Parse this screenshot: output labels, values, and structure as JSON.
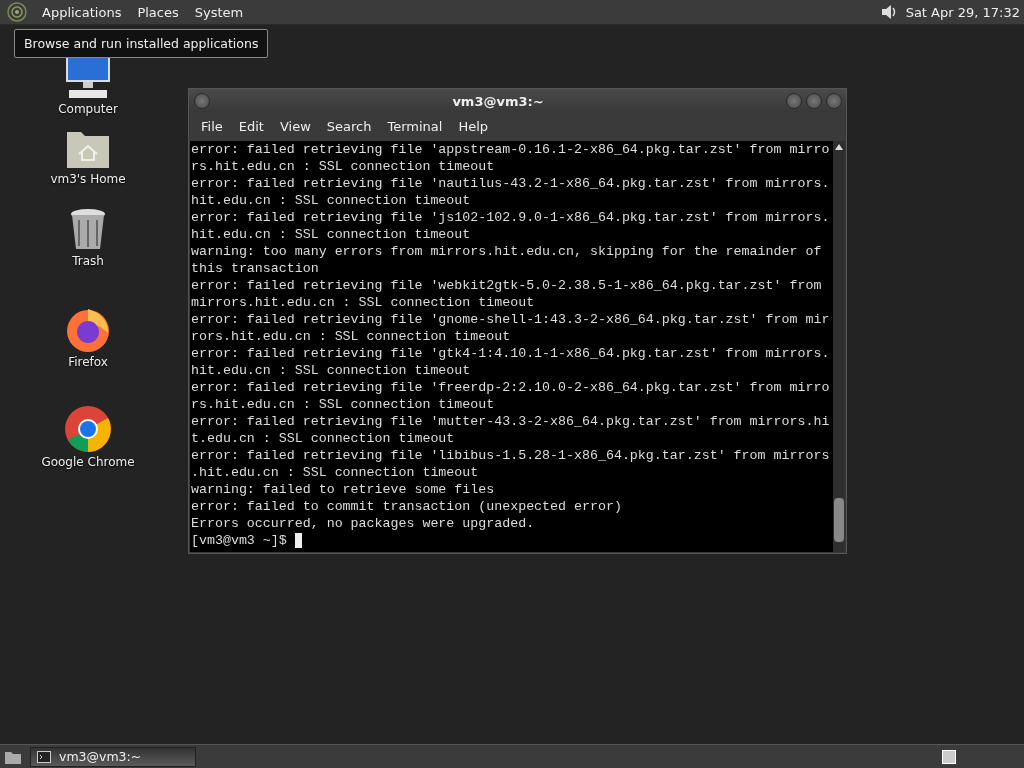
{
  "top_panel": {
    "menus": [
      "Applications",
      "Places",
      "System"
    ],
    "clock": "Sat Apr 29, 17:32"
  },
  "tooltip": "Browse and run installed applications",
  "desktop_icons": [
    {
      "kind": "computer",
      "label": "Computer"
    },
    {
      "kind": "home",
      "label": "vm3's Home"
    },
    {
      "kind": "trash",
      "label": "Trash"
    },
    {
      "kind": "firefox",
      "label": "Firefox"
    },
    {
      "kind": "chrome",
      "label": "Google Chrome"
    }
  ],
  "terminal": {
    "title": "vm3@vm3:~",
    "menu": [
      "File",
      "Edit",
      "View",
      "Search",
      "Terminal",
      "Help"
    ],
    "lines": [
      "error: failed retrieving file 'appstream-0.16.1-2-x86_64.pkg.tar.zst' from mirro",
      "rs.hit.edu.cn : SSL connection timeout",
      "error: failed retrieving file 'nautilus-43.2-1-x86_64.pkg.tar.zst' from mirrors.",
      "hit.edu.cn : SSL connection timeout",
      "error: failed retrieving file 'js102-102.9.0-1-x86_64.pkg.tar.zst' from mirrors.",
      "hit.edu.cn : SSL connection timeout",
      "warning: too many errors from mirrors.hit.edu.cn, skipping for the remainder of",
      "this transaction",
      "error: failed retrieving file 'webkit2gtk-5.0-2.38.5-1-x86_64.pkg.tar.zst' from",
      "mirrors.hit.edu.cn : SSL connection timeout",
      "error: failed retrieving file 'gnome-shell-1:43.3-2-x86_64.pkg.tar.zst' from mir",
      "rors.hit.edu.cn : SSL connection timeout",
      "error: failed retrieving file 'gtk4-1:4.10.1-1-x86_64.pkg.tar.zst' from mirrors.",
      "hit.edu.cn : SSL connection timeout",
      "error: failed retrieving file 'freerdp-2:2.10.0-2-x86_64.pkg.tar.zst' from mirro",
      "rs.hit.edu.cn : SSL connection timeout",
      "error: failed retrieving file 'mutter-43.3-2-x86_64.pkg.tar.zst' from mirrors.hi",
      "t.edu.cn : SSL connection timeout",
      "error: failed retrieving file 'libibus-1.5.28-1-x86_64.pkg.tar.zst' from mirrors",
      ".hit.edu.cn : SSL connection timeout",
      "warning: failed to retrieve some files",
      "error: failed to commit transaction (unexpected error)",
      "Errors occurred, no packages were upgraded."
    ],
    "prompt": "[vm3@vm3 ~]$"
  },
  "taskbar": {
    "windows": [
      {
        "label": "vm3@vm3:~",
        "selected": true
      }
    ]
  }
}
